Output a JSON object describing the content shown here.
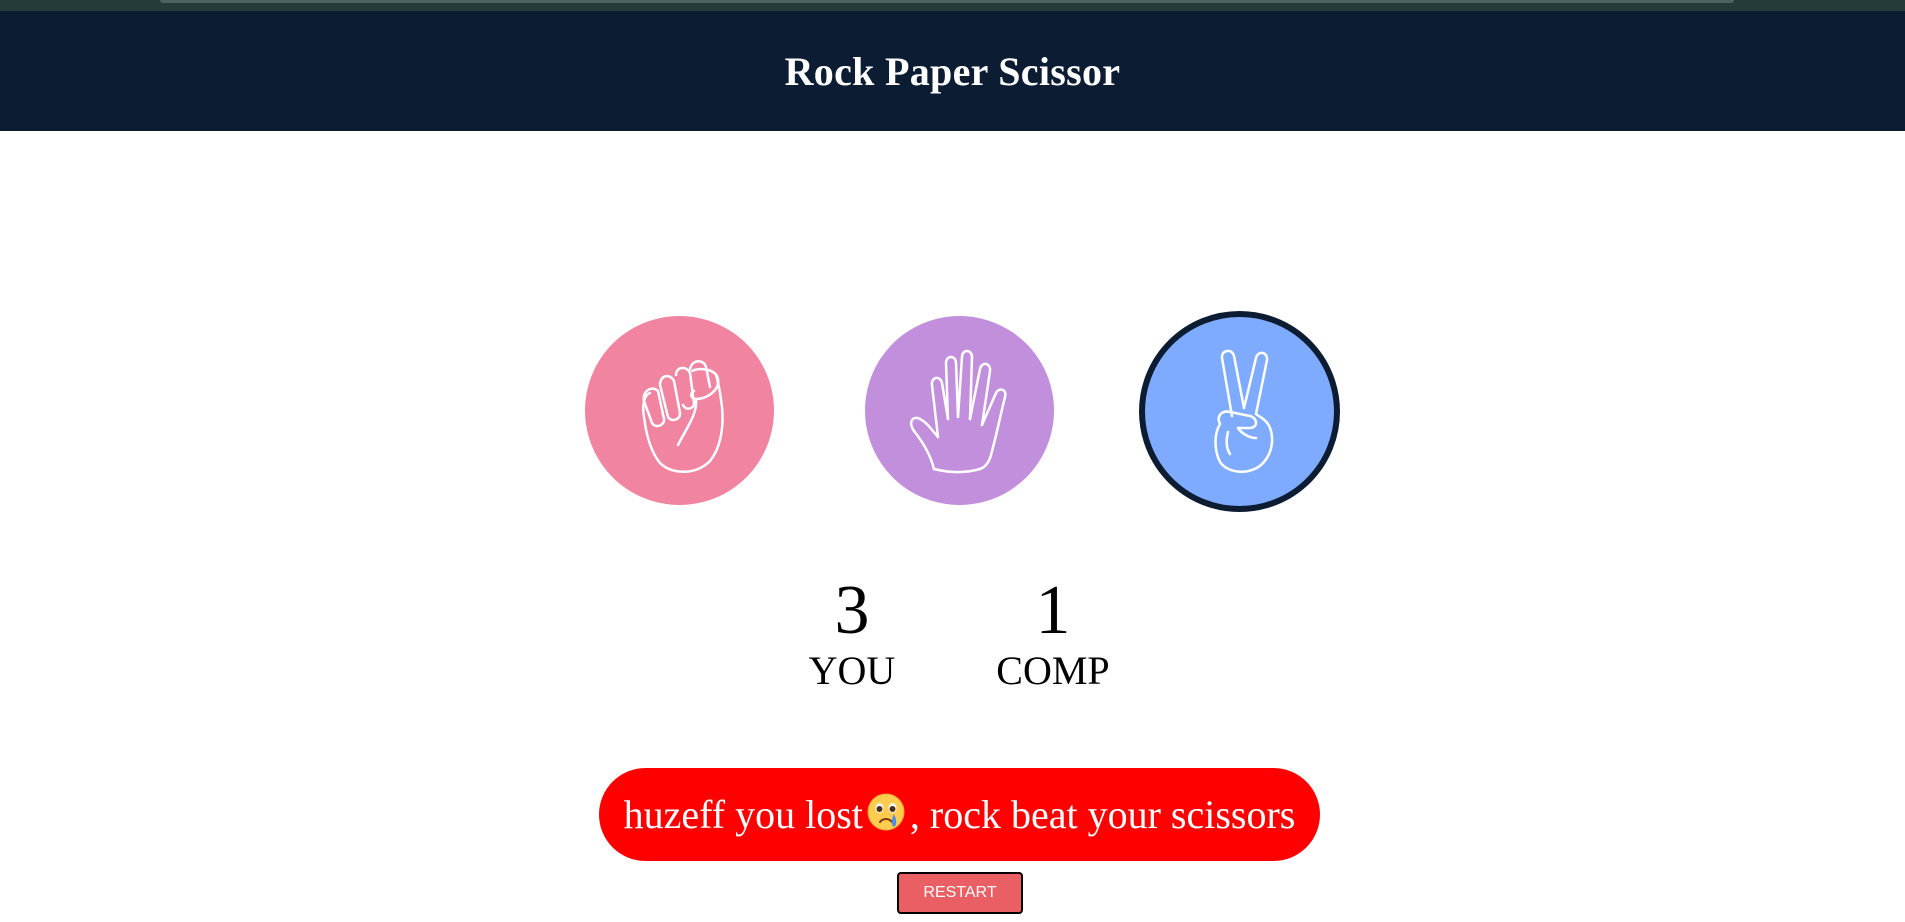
{
  "header": {
    "title": "Rock Paper Scissor"
  },
  "choices": [
    {
      "id": "rock",
      "icon": "fist-hand-icon",
      "color": "#f084a1"
    },
    {
      "id": "paper",
      "icon": "open-hand-icon",
      "color": "#c28fdc"
    },
    {
      "id": "scissors",
      "icon": "peace-hand-icon",
      "color": "#7fabff",
      "selected": true
    }
  ],
  "scoreboard": {
    "user": {
      "score": "3",
      "label": "YOU"
    },
    "computer": {
      "score": "1",
      "label": "COMP"
    }
  },
  "message": {
    "before_emoji": "huzeff you lost",
    "emoji": "crying-face-icon",
    "after_emoji": ", rock beat your scissors",
    "color": "#ff0000"
  },
  "restart": {
    "label": "RESTART"
  },
  "colors": {
    "header": "#0b1c33",
    "restart": "#e95f63"
  }
}
